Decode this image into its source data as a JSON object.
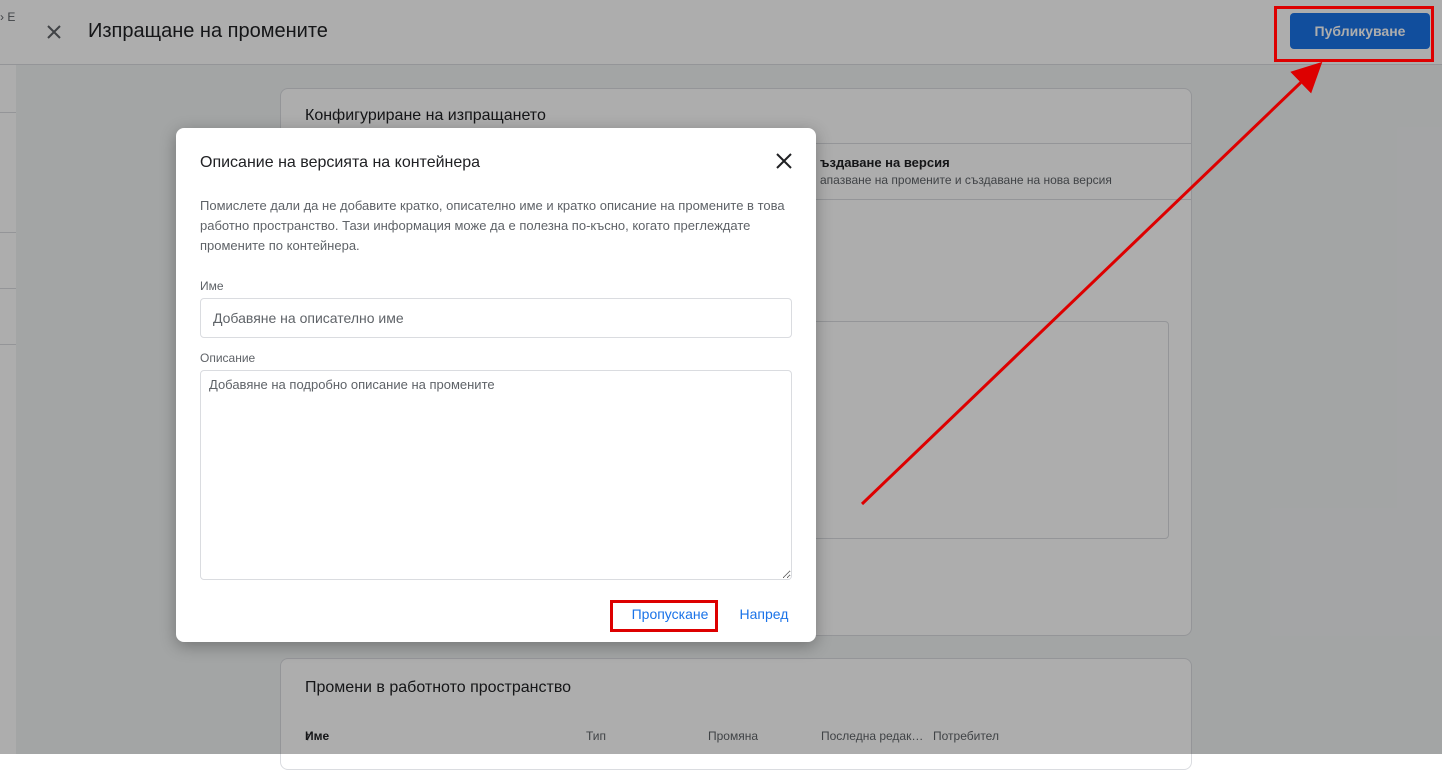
{
  "background": {
    "breadcrumb_fragment": "› E",
    "header": {
      "title": "Изпращане на промените",
      "publish_label": "Публикуване"
    },
    "config_card": {
      "title": "Конфигуриране на изпращането",
      "option_title": "ъздаване на версия",
      "option_subtitle": "апазване на промените и създаване на нова версия"
    },
    "changes_card": {
      "title": "Промени в работното пространство",
      "columns": [
        "Име",
        "Тип",
        "Промяна",
        "Последна редак…",
        "Потребител"
      ]
    }
  },
  "dialog": {
    "title": "Описание на версията на контейнера",
    "help_text": "Помислете дали да не добавите кратко, описателно име и кратко описание на промените в това работно пространство. Тази информация може да е полезна по-късно, когато преглеждате промените по контейнера.",
    "name_label": "Име",
    "name_placeholder": "Добавяне на описателно име",
    "description_label": "Описание",
    "description_placeholder": "Добавяне на подробно описание на промените",
    "skip_label": "Пропускане",
    "next_label": "Напред"
  },
  "colors": {
    "accent": "#1a73e8",
    "annotation": "#dd0000"
  }
}
